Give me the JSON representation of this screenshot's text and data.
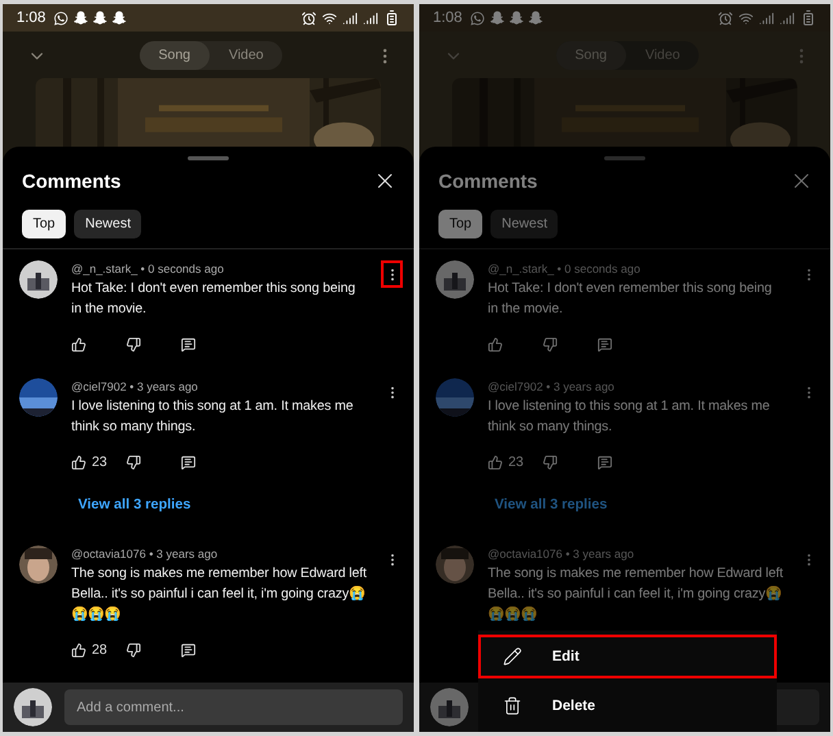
{
  "screens": [
    {
      "dimmed": false,
      "status_bar": {
        "time": "1:08"
      },
      "player": {
        "tabs": [
          {
            "label": "Song",
            "selected": true
          },
          {
            "label": "Video",
            "selected": false
          }
        ]
      },
      "sheet": {
        "title": "Comments",
        "filters": [
          {
            "label": "Top",
            "selected": true
          },
          {
            "label": "Newest",
            "selected": false
          }
        ],
        "comments": [
          {
            "meta": "@_n_.stark_ • 0 seconds ago",
            "text": "Hot Take: I don't even remember this song being in the movie.",
            "actions": true,
            "menu_highlighted": true
          },
          {
            "meta": "@ciel7902 • 3 years ago",
            "text": "I love listening to  this song at 1 am. It makes me think so many things.",
            "actions": true,
            "likes": "23",
            "replies_link": "View all 3 replies",
            "menu_highlighted": false
          },
          {
            "meta": "@octavia1076 • 3 years ago",
            "text": "The song is makes me remember how Edward left Bella.. it's so painful i can feel it, i'm going crazy😭😭😭😭",
            "actions": true,
            "likes": "28",
            "menu_highlighted": false
          }
        ],
        "composer": {
          "placeholder": "Add a comment..."
        }
      }
    },
    {
      "dimmed": true,
      "status_bar": {
        "time": "1:08"
      },
      "player": {
        "tabs": [
          {
            "label": "Song",
            "selected": true
          },
          {
            "label": "Video",
            "selected": false
          }
        ]
      },
      "sheet": {
        "title": "Comments",
        "filters": [
          {
            "label": "Top",
            "selected": true
          },
          {
            "label": "Newest",
            "selected": false
          }
        ],
        "comments": [
          {
            "meta": "@_n_.stark_ • 0 seconds ago",
            "text": "Hot Take: I don't even remember this song being in the movie.",
            "actions": true,
            "menu_highlighted": false
          },
          {
            "meta": "@ciel7902 • 3 years ago",
            "text": "I love listening to  this song at 1 am. It makes me think so many things.",
            "actions": true,
            "likes": "23",
            "replies_link": "View all 3 replies",
            "menu_highlighted": false
          },
          {
            "meta": "@octavia1076 • 3 years ago",
            "text": "The song is makes me remember how Edward left Bella.. it's so painful i can feel it, i'm going crazy😭😭😭😭",
            "actions": false,
            "menu_highlighted": false
          }
        ]
      },
      "menu": {
        "items": [
          {
            "kind": "edit",
            "label": "Edit",
            "highlighted": true
          },
          {
            "kind": "delete",
            "label": "Delete",
            "highlighted": false
          }
        ]
      }
    }
  ]
}
